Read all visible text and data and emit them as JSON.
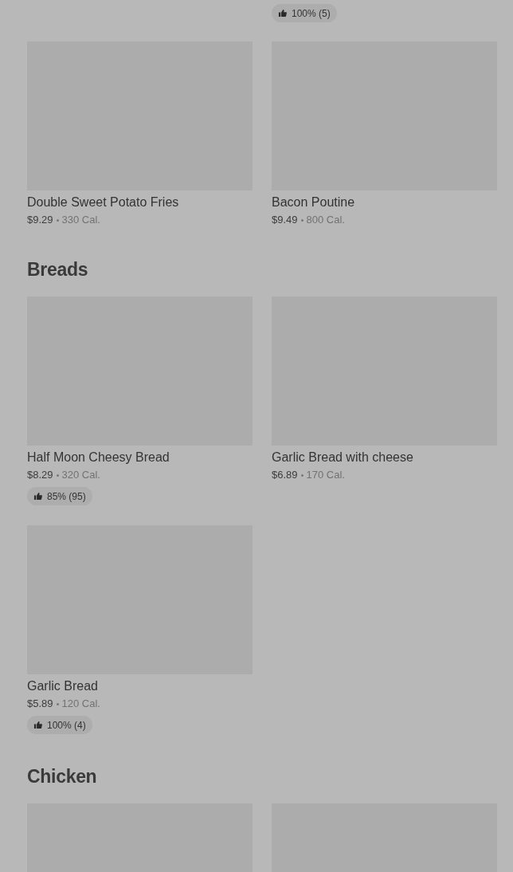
{
  "sections": [
    {
      "items": [
        {
          "kind": "full",
          "name": "Double Sweet Potato Fries",
          "price": "$9.29",
          "calories": "330 Cal."
        },
        {
          "kind": "full",
          "name": "Bacon Poutine",
          "price": "$9.49",
          "calories": "800 Cal."
        }
      ],
      "top_ratings": [
        {
          "kind": "blank"
        },
        {
          "kind": "rating",
          "rating": "100% (5)"
        }
      ]
    },
    {
      "title": "Breads",
      "items": [
        {
          "kind": "full",
          "name": "Half Moon Cheesy Bread",
          "price": "$8.29",
          "calories": "320 Cal.",
          "rating": "85% (95)"
        },
        {
          "kind": "full",
          "name": "Garlic Bread with cheese",
          "price": "$6.89",
          "calories": "170 Cal."
        },
        {
          "kind": "full",
          "name": "Garlic Bread",
          "price": "$5.89",
          "calories": "120 Cal.",
          "rating": "100% (4)"
        }
      ]
    },
    {
      "title": "Chicken",
      "items": [
        {
          "kind": "image_only"
        },
        {
          "kind": "image_only"
        }
      ]
    }
  ]
}
